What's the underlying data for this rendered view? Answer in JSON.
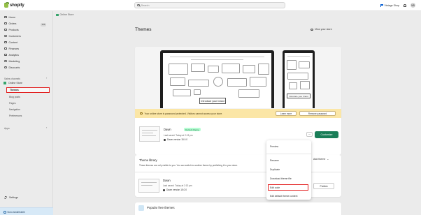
{
  "topbar": {
    "logo_text": "shopify",
    "search_placeholder": "Search",
    "store_name": "Vintage Shop",
    "avatar_initials": "VS"
  },
  "sidebar": {
    "items": [
      {
        "label": "Home"
      },
      {
        "label": "Orders",
        "badge": "166"
      },
      {
        "label": "Products"
      },
      {
        "label": "Customers"
      },
      {
        "label": "Content"
      },
      {
        "label": "Finances"
      },
      {
        "label": "Analytics"
      },
      {
        "label": "Marketing"
      },
      {
        "label": "Discounts"
      }
    ],
    "sales_channels_label": "Sales channels",
    "online_store_label": "Online Store",
    "subnav": [
      {
        "label": "Themes",
        "active": true
      },
      {
        "label": "Blog posts"
      },
      {
        "label": "Pages"
      },
      {
        "label": "Navigation"
      },
      {
        "label": "Preferences"
      }
    ],
    "apps_label": "Apps",
    "settings_label": "Settings",
    "nontransferable_label": "Non-transferable"
  },
  "breadcrumb": {
    "label": "Online Store"
  },
  "page": {
    "title": "Themes",
    "view_store_label": "View your store"
  },
  "preview": {
    "desktop_intro": "Introduce your brand",
    "mobile_intro": "Introduce your brand"
  },
  "banner": {
    "text": "Your online store is password protected. Visitors cannot access your store.",
    "learn_more": "Learn more",
    "remove_password": "Remove password"
  },
  "current_theme": {
    "name": "Dawn",
    "badge": "Current theme",
    "saved": "Last saved: Today at 2:13 pm",
    "version": "Dawn version 15.0.0"
  },
  "actions": {
    "dots": "···",
    "customize": "Customize"
  },
  "menu": {
    "items": [
      {
        "label": "Preview"
      },
      {
        "label": "Rename"
      },
      {
        "label": "Duplicate"
      },
      {
        "label": "Download theme file"
      },
      {
        "label": "Edit code",
        "highlight": true
      },
      {
        "label": "Edit default theme content"
      }
    ]
  },
  "library": {
    "title": "Theme library",
    "description": "These themes are only visible to you. You can switch to another theme by publishing it to your store.",
    "add_theme": "Add theme",
    "theme_name": "Dawn",
    "theme_saved": "Last saved: Today at 2:13 pm",
    "theme_version": "Dawn version 15.0.0",
    "publish": "Publish"
  },
  "popular": {
    "title": "Popular free themes"
  }
}
